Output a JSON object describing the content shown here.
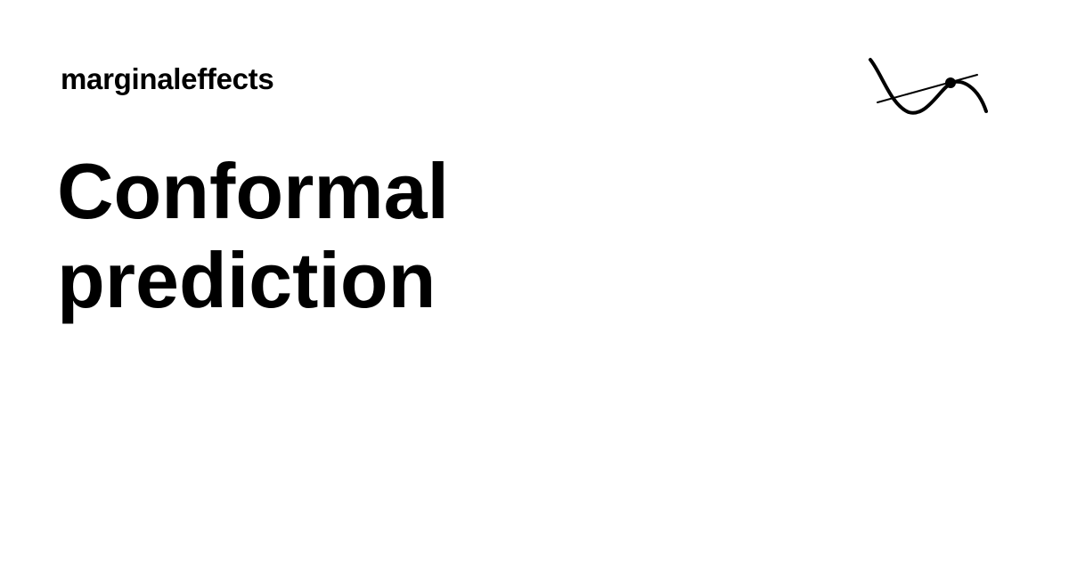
{
  "brand": {
    "name": "marginaleffects",
    "logo_icon": "curve-with-tangent-line-icon"
  },
  "title": {
    "line1": "Conformal",
    "line2": "prediction"
  },
  "colors": {
    "background": "#ffffff",
    "text": "#000000"
  }
}
